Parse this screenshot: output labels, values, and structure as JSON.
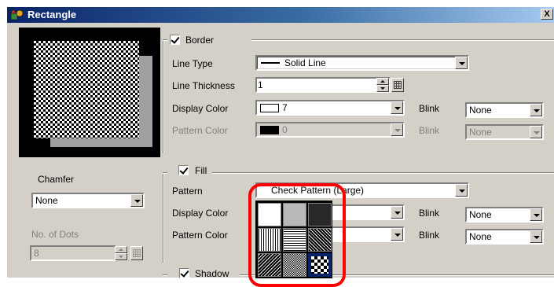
{
  "window": {
    "title": "Rectangle",
    "close_label": "X"
  },
  "border_group": {
    "label": "Border",
    "checked": true
  },
  "line_type": {
    "label": "Line Type",
    "value": "Solid Line"
  },
  "line_thickness": {
    "label": "Line Thickness",
    "value": "1"
  },
  "border_display_color": {
    "label": "Display Color",
    "value": "7",
    "blink_label": "Blink",
    "blink_value": "None"
  },
  "border_pattern_color": {
    "label": "Pattern Color",
    "value": "0",
    "blink_label": "Blink",
    "blink_value": "None"
  },
  "chamfer": {
    "label": "Chamfer",
    "value": "None"
  },
  "no_of_dots": {
    "label": "No. of Dots",
    "value": "8"
  },
  "fill_group": {
    "label": "Fill",
    "checked": true
  },
  "fill_pattern": {
    "label": "Pattern",
    "value": "Check Pattern (Large)"
  },
  "fill_display_color": {
    "label": "Display Color",
    "blink_label": "Blink",
    "blink_value": "None"
  },
  "fill_pattern_color": {
    "label": "Pattern Color",
    "blink_label": "Blink",
    "blink_value": "None"
  },
  "shadow_group": {
    "label": "Shadow",
    "checked": true
  },
  "pattern_popup": {
    "patterns": [
      "white",
      "fine-dots",
      "dense-dots",
      "vertical-lines",
      "horizontal-lines",
      "diagonal-lines-right",
      "diagonal-lines-left",
      "small-check",
      "large-check"
    ],
    "selected": "large-check"
  },
  "colors": {
    "highlight": "#ff0000",
    "title_bar": "#0a246a",
    "selection": "#0a246a"
  }
}
